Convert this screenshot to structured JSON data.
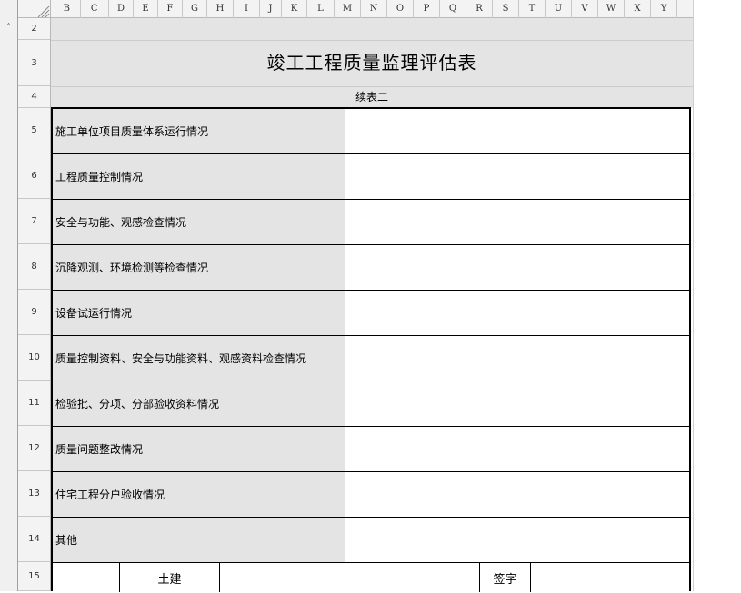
{
  "columns": [
    "B",
    "C",
    "D",
    "E",
    "F",
    "G",
    "H",
    "I",
    "J",
    "K",
    "L",
    "M",
    "N",
    "O",
    "P",
    "Q",
    "R",
    "S",
    "T",
    "U",
    "V",
    "W",
    "X",
    "Y"
  ],
  "row_numbers": [
    "2",
    "3",
    "4",
    "5",
    "6",
    "7",
    "8",
    "9",
    "10",
    "11",
    "12",
    "13",
    "14",
    "15"
  ],
  "form": {
    "title": "竣工工程质量监理评估表",
    "subtitle": "续表二",
    "rows": [
      {
        "label": "施工单位项目质量体系运行情况",
        "value": ""
      },
      {
        "label": "工程质量控制情况",
        "value": ""
      },
      {
        "label": "安全与功能、观感检查情况",
        "value": ""
      },
      {
        "label": "沉降观测、环境检测等检查情况",
        "value": ""
      },
      {
        "label": "设备试运行情况",
        "value": ""
      },
      {
        "label": "质量控制资料、安全与功能资料、观感资料检查情况",
        "value": ""
      },
      {
        "label": "检验批、分项、分部验收资料情况",
        "value": ""
      },
      {
        "label": "质量问题整改情况",
        "value": ""
      },
      {
        "label": "住宅工程分户验收情况",
        "value": ""
      },
      {
        "label": "其他",
        "value": ""
      }
    ],
    "row15": {
      "cell1": "",
      "cell2": "土建",
      "cell3": "",
      "cell4": "签字",
      "cell5": ""
    }
  },
  "colors": {
    "header_bg": "#f3f3f3",
    "label_bg": "#e4e4e4",
    "border": "#000000"
  }
}
